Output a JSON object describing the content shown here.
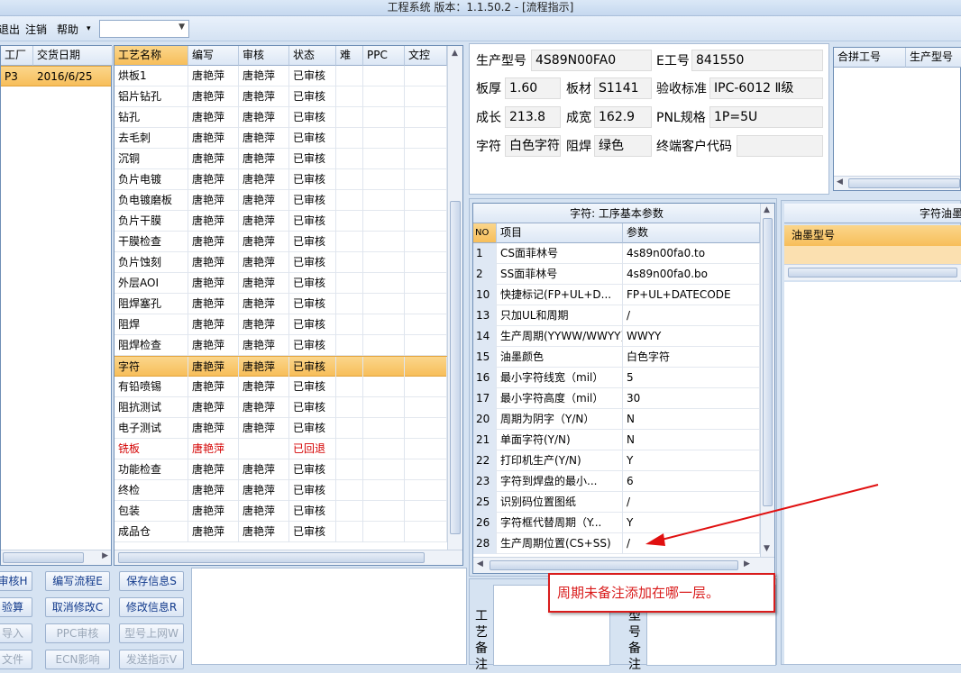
{
  "window": {
    "title": "工程系统  版本：1.1.50.2 - [流程指示]"
  },
  "menu": {
    "items": [
      "退出",
      "注销",
      "帮助"
    ],
    "help_arrow": "▾",
    "combo_value": ""
  },
  "left_grid": {
    "headers": [
      "工厂",
      "交货日期"
    ],
    "rows": [
      {
        "factory": "P3",
        "date": "2016/6/25"
      }
    ]
  },
  "process_grid": {
    "headers": [
      "工艺名称",
      "编写",
      "审核",
      "状态",
      "难",
      "PPC",
      "文控"
    ],
    "selected_index": 14,
    "rows": [
      {
        "name": "烘板1",
        "writer": "唐艳萍",
        "reviewer": "唐艳萍",
        "status": "已审核"
      },
      {
        "name": "铝片钻孔",
        "writer": "唐艳萍",
        "reviewer": "唐艳萍",
        "status": "已审核"
      },
      {
        "name": "钻孔",
        "writer": "唐艳萍",
        "reviewer": "唐艳萍",
        "status": "已审核"
      },
      {
        "name": "去毛刺",
        "writer": "唐艳萍",
        "reviewer": "唐艳萍",
        "status": "已审核"
      },
      {
        "name": "沉铜",
        "writer": "唐艳萍",
        "reviewer": "唐艳萍",
        "status": "已审核"
      },
      {
        "name": "负片电镀",
        "writer": "唐艳萍",
        "reviewer": "唐艳萍",
        "status": "已审核"
      },
      {
        "name": "负电镀磨板",
        "writer": "唐艳萍",
        "reviewer": "唐艳萍",
        "status": "已审核"
      },
      {
        "name": "负片干膜",
        "writer": "唐艳萍",
        "reviewer": "唐艳萍",
        "status": "已审核"
      },
      {
        "name": "干膜检查",
        "writer": "唐艳萍",
        "reviewer": "唐艳萍",
        "status": "已审核"
      },
      {
        "name": "负片蚀刻",
        "writer": "唐艳萍",
        "reviewer": "唐艳萍",
        "status": "已审核"
      },
      {
        "name": "外层AOI",
        "writer": "唐艳萍",
        "reviewer": "唐艳萍",
        "status": "已审核"
      },
      {
        "name": "阻焊塞孔",
        "writer": "唐艳萍",
        "reviewer": "唐艳萍",
        "status": "已审核"
      },
      {
        "name": "阻焊",
        "writer": "唐艳萍",
        "reviewer": "唐艳萍",
        "status": "已审核"
      },
      {
        "name": "阻焊检查",
        "writer": "唐艳萍",
        "reviewer": "唐艳萍",
        "status": "已审核"
      },
      {
        "name": "字符",
        "writer": "唐艳萍",
        "reviewer": "唐艳萍",
        "status": "已审核"
      },
      {
        "name": "有铅喷锡",
        "writer": "唐艳萍",
        "reviewer": "唐艳萍",
        "status": "已审核"
      },
      {
        "name": "阻抗测试",
        "writer": "唐艳萍",
        "reviewer": "唐艳萍",
        "status": "已审核"
      },
      {
        "name": "电子测试",
        "writer": "唐艳萍",
        "reviewer": "唐艳萍",
        "status": "已审核"
      },
      {
        "name": "铣板",
        "writer": "唐艳萍",
        "reviewer": "",
        "status": "已回退",
        "red": true
      },
      {
        "name": "功能检查",
        "writer": "唐艳萍",
        "reviewer": "唐艳萍",
        "status": "已审核"
      },
      {
        "name": "终检",
        "writer": "唐艳萍",
        "reviewer": "唐艳萍",
        "status": "已审核"
      },
      {
        "name": "包装",
        "writer": "唐艳萍",
        "reviewer": "唐艳萍",
        "status": "已审核"
      },
      {
        "name": "成品仓",
        "writer": "唐艳萍",
        "reviewer": "唐艳萍",
        "status": "已审核"
      }
    ]
  },
  "buttons": [
    {
      "label": "审核H",
      "name": "review-button",
      "disabled": false
    },
    {
      "label": "编写流程E",
      "name": "write-flow-button",
      "disabled": false
    },
    {
      "label": "保存信息S",
      "name": "save-info-button",
      "disabled": false
    },
    {
      "label": "验算",
      "name": "verify-button",
      "disabled": false
    },
    {
      "label": "取消修改C",
      "name": "cancel-edit-button",
      "disabled": false
    },
    {
      "label": "修改信息R",
      "name": "edit-info-button",
      "disabled": false
    },
    {
      "label": "导入",
      "name": "import-button",
      "disabled": true
    },
    {
      "label": "PPC审核",
      "name": "ppc-review-button",
      "disabled": true
    },
    {
      "label": "型号上网W",
      "name": "model-online-button",
      "disabled": true
    },
    {
      "label": "文件",
      "name": "file-button",
      "disabled": true
    },
    {
      "label": "ECN影响",
      "name": "ecn-impact-button",
      "disabled": true
    },
    {
      "label": "发送指示V",
      "name": "send-instruction-button",
      "disabled": true
    }
  ],
  "info": {
    "model_label": "生产型号",
    "model": "4S89N00FA0",
    "e_no_label": "E工号",
    "e_no": "841550",
    "thickness_label": "板厚",
    "thickness": "1.60",
    "material_label": "板材",
    "material": "S1141",
    "standard_label": "验收标准",
    "standard": "IPC-6012 Ⅱ级",
    "length_label": "成长",
    "length": "213.8",
    "width_label": "成宽",
    "width": "162.9",
    "pnl_label": "PNL规格",
    "pnl": "1P=5U",
    "char_label": "字符",
    "char": "白色字符",
    "mask_label": "阻焊",
    "mask": "绿色",
    "customer_label": "终端客户代码",
    "customer": ""
  },
  "merge_grid": {
    "headers": [
      "合拼工号",
      "生产型号"
    ]
  },
  "params": {
    "title": "字符: 工序基本参数",
    "headers": [
      "NO",
      "项目",
      "参数"
    ],
    "rows": [
      {
        "no": "1",
        "item": "CS面菲林号",
        "value": "4s89n00fa0.to"
      },
      {
        "no": "2",
        "item": "SS面菲林号",
        "value": "4s89n00fa0.bo"
      },
      {
        "no": "10",
        "item": "快捷标记(FP+UL+D...",
        "value": "FP+UL+DATECODE"
      },
      {
        "no": "13",
        "item": "只加UL和周期",
        "value": "/"
      },
      {
        "no": "14",
        "item": "生产周期(YYWW/WWYY)",
        "value": "WWYY"
      },
      {
        "no": "15",
        "item": "油墨颜色",
        "value": "白色字符"
      },
      {
        "no": "16",
        "item": "最小字符线宽（mil）",
        "value": "5"
      },
      {
        "no": "17",
        "item": "最小字符高度（mil）",
        "value": "30"
      },
      {
        "no": "20",
        "item": "周期为阴字（Y/N）",
        "value": "N"
      },
      {
        "no": "21",
        "item": "单面字符(Y/N)",
        "value": "N"
      },
      {
        "no": "22",
        "item": "打印机生产(Y/N)",
        "value": "Y"
      },
      {
        "no": "23",
        "item": "字符到焊盘的最小...",
        "value": "6"
      },
      {
        "no": "25",
        "item": "识别码位置图纸",
        "value": "/"
      },
      {
        "no": "26",
        "item": "字符框代替周期（Y...",
        "value": "Y"
      },
      {
        "no": "28",
        "item": "生产周期位置(CS+SS)",
        "value": "/"
      }
    ]
  },
  "ink": {
    "title": "字符油墨",
    "header": "油墨型号"
  },
  "remarks": {
    "process_label": "工艺备注",
    "model_label": "型号备注"
  },
  "annotation": {
    "text": "周期未备注添加在哪一层。"
  }
}
